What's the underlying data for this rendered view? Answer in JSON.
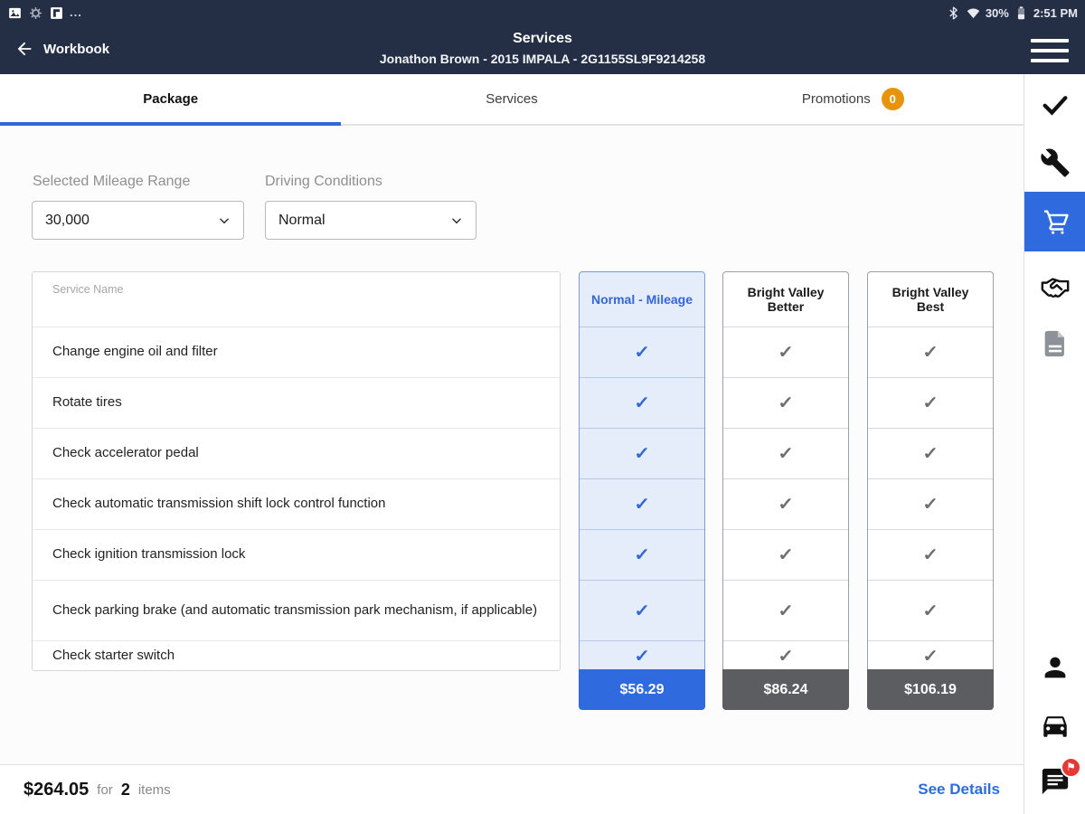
{
  "status_bar": {
    "more": "...",
    "battery_pct": "30%",
    "time": "2:51 PM"
  },
  "app_bar": {
    "back": "Workbook",
    "title": "Services",
    "subtitle": "Jonathon Brown - 2015 IMPALA - 2G1155SL9F9214258"
  },
  "tabs": [
    {
      "label": "Package"
    },
    {
      "label": "Services"
    },
    {
      "label": "Promotions",
      "badge": "0"
    }
  ],
  "filters": {
    "mileage_label": "Selected Mileage Range",
    "mileage_value": "30,000",
    "conditions_label": "Driving Conditions",
    "conditions_value": "Normal"
  },
  "table": {
    "name_header": "Service Name",
    "services": [
      "Change engine oil and filter",
      "Rotate tires",
      "Check accelerator pedal",
      "Check automatic transmission shift lock control function",
      "Check ignition transmission lock",
      "Check parking brake (and automatic transmission park mechanism, if applicable)",
      "Check starter switch"
    ],
    "columns": [
      {
        "name": "Normal - Mileage",
        "price": "$56.29",
        "highlighted": true
      },
      {
        "name": "Bright Valley Better",
        "price": "$86.24",
        "highlighted": false
      },
      {
        "name": "Bright Valley Best",
        "price": "$106.19",
        "highlighted": false
      }
    ]
  },
  "summary": {
    "total": "$264.05",
    "for_label": "for",
    "count": "2",
    "items_label": "items",
    "details": "See Details"
  },
  "glyphs": {
    "check": "✓",
    "flag": "⚑"
  },
  "colors": {
    "app_bar": "#242F45",
    "accent_blue": "#3367D6",
    "price_blue": "#2F6BDE",
    "price_gray": "#5B5D60",
    "column_highlight_bg": "#E5ECFA",
    "badge_orange": "#E8930C",
    "chat_badge_red": "#E53935"
  }
}
